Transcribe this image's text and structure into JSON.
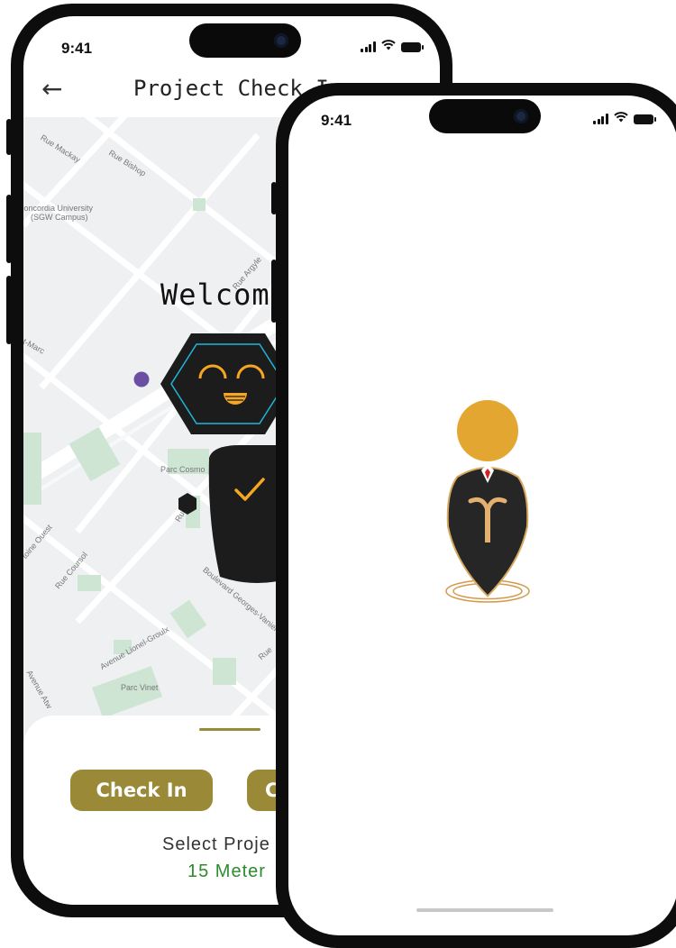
{
  "back_phone": {
    "status_time": "9:41",
    "header": {
      "title": "Project Check In"
    },
    "map_labels": [
      "Rue Mackay",
      "Rue Bishop",
      "Concordia University",
      "(SGW Campus)",
      "Rue Argyle",
      "nt-Marc",
      "Parc Cosmo",
      "Rue O",
      "toine Ouest",
      "Rue Coursol",
      "Boulevard Georges-Vanier",
      "Avenue Lionel-Groulx",
      "Parc Vinet",
      "Avenue Atw",
      "Rue"
    ],
    "welcome_text": "Welcom",
    "bottom_sheet": {
      "check_in_label": "Check In",
      "second_button_label": "C",
      "select_text": "Select Proje",
      "distance_text": "15 Meter"
    }
  },
  "front_phone": {
    "status_time": "9:41"
  },
  "colors": {
    "accent_gold": "#9a8a37",
    "logo_orange": "#e3a630",
    "distance_green": "#2e8b2e",
    "robot_cyan": "#1fb6d9",
    "robot_orange": "#f5a623"
  }
}
